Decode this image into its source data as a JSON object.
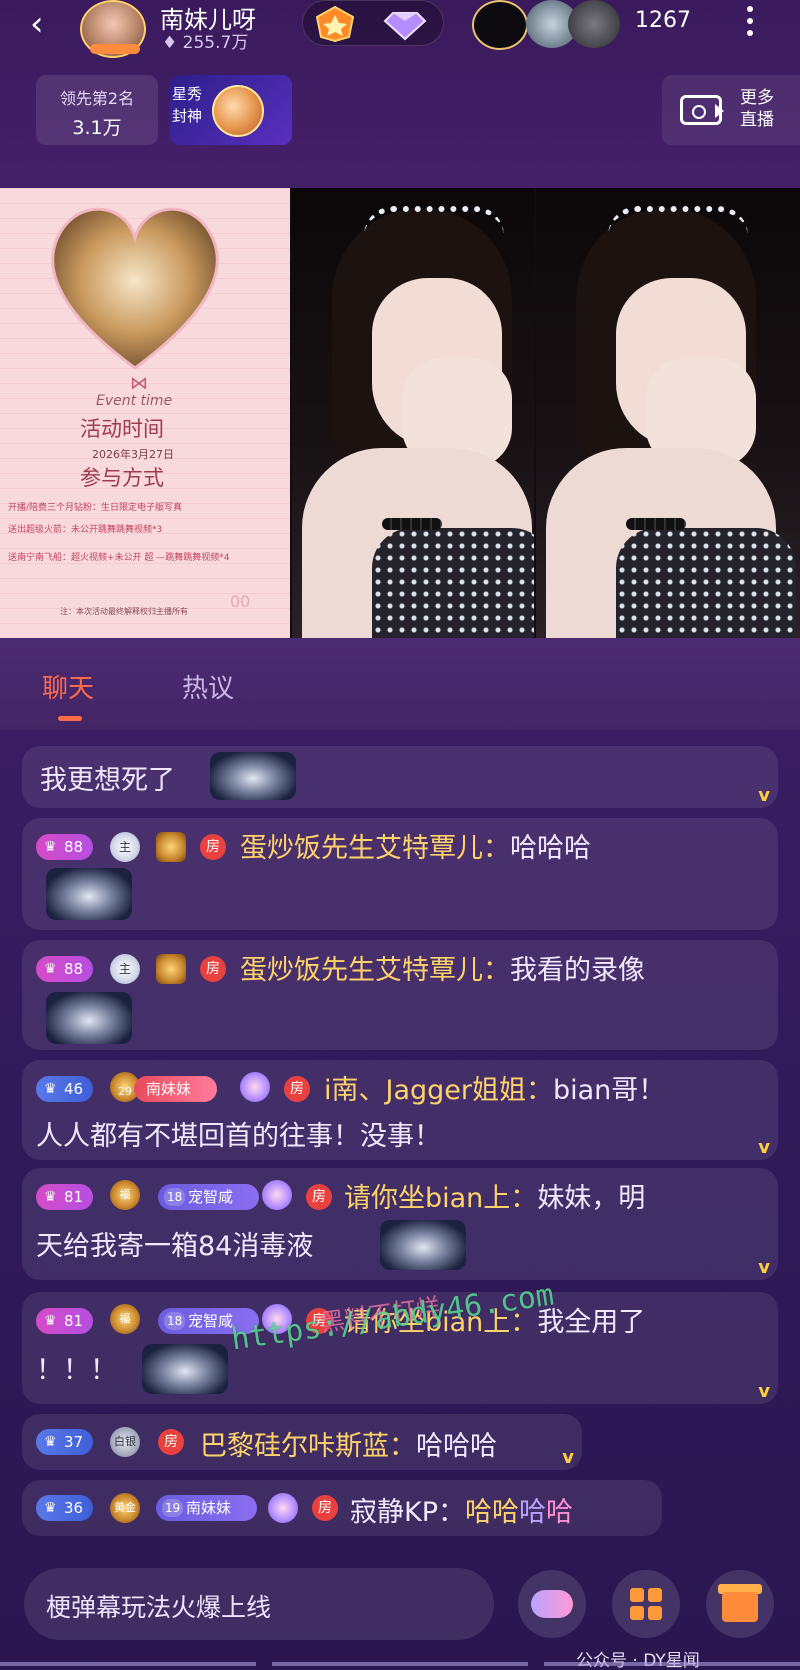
{
  "header": {
    "back_icon": "back-arrow-icon",
    "streamer_name": "南妹儿呀",
    "streamer_fans": "255.7万",
    "viewer_count": "1267"
  },
  "rank": {
    "label": "领先第2名",
    "value": "3.1万"
  },
  "event_banner": {
    "text": "星秀 封神"
  },
  "more_live": {
    "label_line1": "更多",
    "label_line2": "直播"
  },
  "poster": {
    "script": "Event time",
    "heading1": "活动时间",
    "date": "2026年3月27日",
    "heading2": "参与方式",
    "lines": [
      "开播/陪费三个月钻粉：生日限定电子版写真",
      "送出超级火箭：未公开跳舞跳舞视频*3",
      "送南宁南飞船：超火视频+未公开 超 —跳舞跳舞视频*4"
    ],
    "foot": "注：本次活动最终解释权归主播所有",
    "partial_text": "00"
  },
  "tabs": {
    "chat": "聊天",
    "hot": "热议"
  },
  "messages": [
    {
      "text": "我更想死了"
    },
    {
      "level": "88",
      "badge_text": "主",
      "room": "房",
      "name": "蛋炒饭先生艾特覃儿：",
      "text": "哈哈哈"
    },
    {
      "level": "88",
      "badge_text": "主",
      "room": "房",
      "name": "蛋炒饭先生艾特覃儿：",
      "text": "我看的录像"
    },
    {
      "level": "46",
      "fan_num": "29",
      "fan_name": "南妹妹",
      "room": "房",
      "name": "i南、Jagger姐姐：",
      "text_line1": "bian哥！",
      "text_line2": "人人都有不堪回首的往事！没事！"
    },
    {
      "level": "81",
      "badge_text": "福",
      "fan_num": "18",
      "fan_name": "宠智咸",
      "room": "房",
      "name": "请你坐bian上：",
      "text_line1": "妹妹，明",
      "text_line2": "天给我寄一箱84消毒液"
    },
    {
      "level": "81",
      "badge_text": "福",
      "fan_num": "18",
      "fan_name": "宠智咸",
      "room": "房",
      "name": "请你坐bian上：",
      "text_line1": "我全用了",
      "text_line2": "！！！"
    },
    {
      "level": "37",
      "badge_text": "白银",
      "room": "房",
      "name": "巴黎硅尔咔斯蓝：",
      "text": "哈哈哈"
    },
    {
      "level": "36",
      "badge_text": "黄金",
      "fan_num": "19",
      "fan_name": "南妹妹",
      "room": "房",
      "name": "寂静KP：",
      "text_parts": [
        "哈哈",
        "哈",
        "哈"
      ]
    }
  ],
  "watermark": {
    "url": "https://abdy46.com",
    "text": "黑料不打烊"
  },
  "bottom": {
    "input_placeholder": "梗弹幕玩法火爆上线",
    "credit": "公众号 · DY星闻"
  },
  "colors": {
    "accent": "#ff6a4a",
    "name": "#ffd36a",
    "background": "#3b1d63"
  }
}
